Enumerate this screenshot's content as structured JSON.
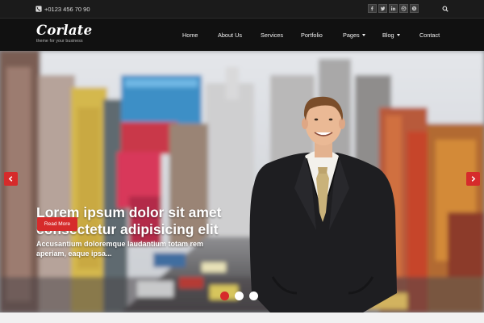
{
  "topbar": {
    "phone": "+0123 456 70 90",
    "social_icons": [
      "facebook-icon",
      "twitter-icon",
      "linkedin-icon",
      "dribbble-icon",
      "skype-icon"
    ],
    "search_icon": "search-icon"
  },
  "header": {
    "logo": "Corlate",
    "tagline": "theme for your business"
  },
  "nav": {
    "home": "Home",
    "about": "About Us",
    "services": "Services",
    "portfolio": "Portfolio",
    "pages": "Pages",
    "blog": "Blog",
    "contact": "Contact"
  },
  "hero": {
    "title_line1": "Lorem ipsum dolor sit amet",
    "title_line2": "consectetur adipisicing elit",
    "subtitle": "Accusantium doloremque laudantium totam rem aperiam, eaque ipsa...",
    "button": "Read More",
    "active_slide": 1,
    "slide_count": 3
  },
  "colors": {
    "accent": "#d62b2b",
    "topbar_bg": "#1b1b1b",
    "header_bg": "#111111"
  }
}
